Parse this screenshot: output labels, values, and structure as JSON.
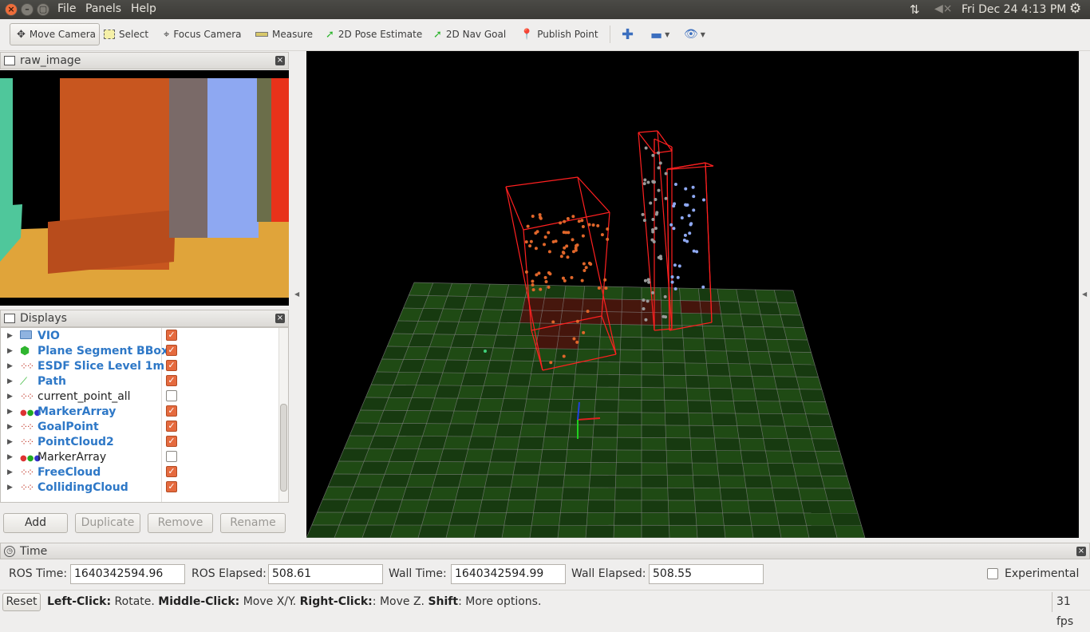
{
  "window": {
    "menu": [
      "File",
      "Panels",
      "Help"
    ],
    "clock": "Fri Dec 24  4:13 PM"
  },
  "toolbar": {
    "move_camera": "Move Camera",
    "select": "Select",
    "focus_camera": "Focus Camera",
    "measure": "Measure",
    "pose_estimate": "2D Pose Estimate",
    "nav_goal": "2D Nav Goal",
    "publish_point": "Publish Point"
  },
  "raw_image": {
    "title": "raw_image"
  },
  "displays": {
    "title": "Displays",
    "items": [
      {
        "label": "VIO",
        "checked": true,
        "icon": "folder-icon"
      },
      {
        "label": "Plane Segment BBox",
        "checked": true,
        "icon": "cube-icon"
      },
      {
        "label": "ESDF Slice Level 1m",
        "checked": true,
        "icon": "pointcloud-icon"
      },
      {
        "label": "Path",
        "checked": true,
        "icon": "path-icon"
      },
      {
        "label": "current_point_all",
        "checked": false,
        "icon": "pointcloud-icon"
      },
      {
        "label": "MarkerArray",
        "checked": true,
        "icon": "marker-array-icon"
      },
      {
        "label": "GoalPoint",
        "checked": true,
        "icon": "pointcloud-icon"
      },
      {
        "label": "PointCloud2",
        "checked": true,
        "icon": "pointcloud-icon"
      },
      {
        "label": "MarkerArray",
        "checked": false,
        "icon": "marker-array-icon"
      },
      {
        "label": "FreeCloud",
        "checked": true,
        "icon": "pointcloud-icon"
      },
      {
        "label": "CollidingCloud",
        "checked": true,
        "icon": "pointcloud-icon"
      }
    ],
    "buttons": {
      "add": "Add",
      "duplicate": "Duplicate",
      "remove": "Remove",
      "rename": "Rename"
    }
  },
  "time": {
    "title": "Time",
    "ros_time_label": "ROS Time:",
    "ros_time": "1640342594.96",
    "ros_elapsed_label": "ROS Elapsed:",
    "ros_elapsed": "508.61",
    "wall_time_label": "Wall Time:",
    "wall_time": "1640342594.99",
    "wall_elapsed_label": "Wall Elapsed:",
    "wall_elapsed": "508.55",
    "experimental_label": "Experimental"
  },
  "status": {
    "reset": "Reset",
    "hint_left_key": "Left-Click:",
    "hint_left": " Rotate. ",
    "hint_middle_key": "Middle-Click:",
    "hint_middle": " Move X/Y. ",
    "hint_right_key": "Right-Click:",
    "hint_right": ": Move Z. ",
    "hint_shift_key": "Shift",
    "hint_shift": ": More options.",
    "fps": "31 fps"
  }
}
